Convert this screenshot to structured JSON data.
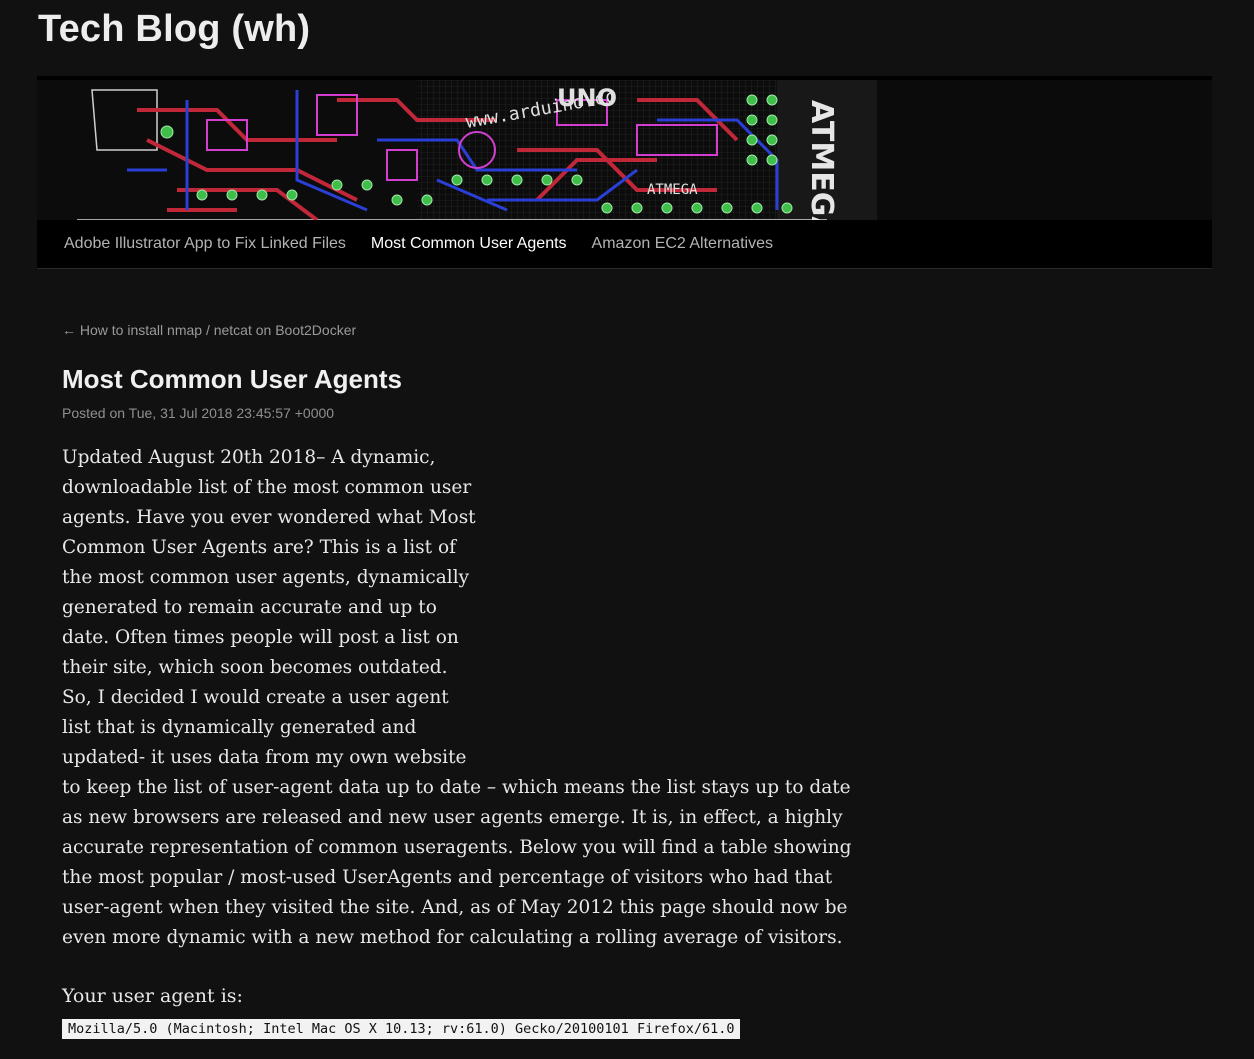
{
  "site": {
    "title": "Tech Blog (wh)"
  },
  "banner": {
    "alt": "circuit board banner",
    "text_uno": "UNO",
    "text_url": "www.arduino.cc",
    "text_chip": "ATMEGA"
  },
  "nav": {
    "items": [
      {
        "label": "Adobe Illustrator App to Fix Linked Files",
        "active": false
      },
      {
        "label": "Most Common User Agents",
        "active": true
      },
      {
        "label": "Amazon EC2 Alternatives",
        "active": false
      }
    ]
  },
  "post": {
    "prev_link": "← How to install nmap / netcat on Boot2Docker",
    "title": "Most Common User Agents",
    "meta": "Posted on Tue, 31 Jul 2018 23:45:57 +0000",
    "body": "Updated August 20th 2018– A dynamic, downloadable list of the most common user agents. Have you ever wondered what Most Common User Agents are? This is a list of the most common user agents, dynamically generated to remain accurate and up to date. Often times people will post a list on their site, which soon becomes outdated. So, I decided I would create a user agent list that is dynamically generated and updated- it uses data from my own website to keep the list of user-agent data up to date – which means the list stays up to date as new browsers are released and new user agents emerge. It is, in effect, a highly accurate representation of common useragents. Below you will find a table showing the most popular / most-used UserAgents and percentage of visitors who had that user-agent when they visited the site. And, as of May 2012 this page should now be even more dynamic with a new method for calculating a rolling average of visitors.",
    "ua_label": "Your user agent is:",
    "ua_value": "Mozilla/5.0 (Macintosh; Intel Mac OS X 10.13; rv:61.0) Gecko/20100101 Firefox/61.0"
  },
  "colors": {
    "background": "#111111",
    "nav_background": "#000000",
    "pcb_red": "#c0283a",
    "pcb_blue": "#2a3fd6",
    "pcb_green": "#3fbf4a",
    "pcb_magenta": "#d23fd0"
  }
}
